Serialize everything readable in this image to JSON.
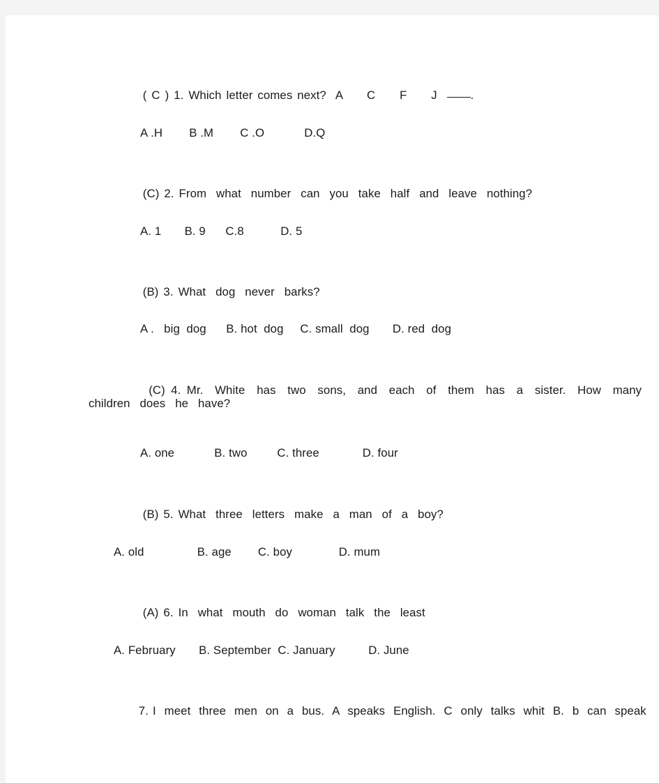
{
  "page": {
    "background_color": "#f4f4f4",
    "sheet_color": "#ffffff",
    "text_color": "#1b1b20"
  },
  "questions": [
    {
      "marked_answer": "( C )",
      "number": "1.",
      "stem": "Which letter comes next?",
      "sequence": "A     C     F     J",
      "trailing": ".",
      "options_text": "A .H        B .M        C .O            D.Q",
      "options": [
        {
          "label": "A .",
          "text": "H"
        },
        {
          "label": "B .",
          "text": "M"
        },
        {
          "label": "C .",
          "text": "O"
        },
        {
          "label": "D.",
          "text": "Q"
        }
      ]
    },
    {
      "marked_answer": "(C)",
      "number": "2.",
      "stem": "From  what  number  can  you  take  half  and  leave  nothing?",
      "options_text": "A. 1       B. 9      C.8           D. 5",
      "options": [
        {
          "label": "A.",
          "text": "1"
        },
        {
          "label": "B.",
          "text": "9"
        },
        {
          "label": "C.",
          "text": "8"
        },
        {
          "label": "D.",
          "text": "5"
        }
      ]
    },
    {
      "marked_answer": "(B)",
      "number": "3.",
      "stem": "What  dog  never  barks?",
      "options_text": "A .   big  dog      B. hot  dog     C. small  dog       D. red  dog",
      "options": [
        {
          "label": "A .",
          "text": "big dog"
        },
        {
          "label": "B.",
          "text": "hot dog"
        },
        {
          "label": "C.",
          "text": "small dog"
        },
        {
          "label": "D.",
          "text": "red dog"
        }
      ]
    },
    {
      "marked_answer": "(C)",
      "number": "4.",
      "stem_line1": "Mr.  White  has  two  sons,  and  each  of  them  has  a  sister.  How  many",
      "stem_line2": "children  does  he  have?",
      "options_text": "A. one            B. two         C. three             D. four",
      "options": [
        {
          "label": "A.",
          "text": "one"
        },
        {
          "label": "B.",
          "text": "two"
        },
        {
          "label": "C.",
          "text": "three"
        },
        {
          "label": "D.",
          "text": "four"
        }
      ]
    },
    {
      "marked_answer": "(B)",
      "number": "5.",
      "stem": "What  three  letters  make  a  man  of  a  boy?",
      "options_text": "A. old                B. age        C. boy              D. mum",
      "options": [
        {
          "label": "A.",
          "text": "old"
        },
        {
          "label": "B.",
          "text": "age"
        },
        {
          "label": "C.",
          "text": "boy"
        },
        {
          "label": "D.",
          "text": "mum"
        }
      ]
    },
    {
      "marked_answer": "(A)",
      "number": "6.",
      "stem": "In  what  mouth  do  woman  talk  the  least",
      "options_text": "A. February       B. September  C. January          D. June",
      "options": [
        {
          "label": "A.",
          "text": "February"
        },
        {
          "label": "B.",
          "text": "September"
        },
        {
          "label": "C.",
          "text": "January"
        },
        {
          "label": "D.",
          "text": "June"
        }
      ]
    },
    {
      "marked_answer": "",
      "number": "7.",
      "stem": "I  meet  three  men  on  a  bus.  A  speaks  English.  C  only  talks  whit  B.  b  can  speak"
    }
  ]
}
